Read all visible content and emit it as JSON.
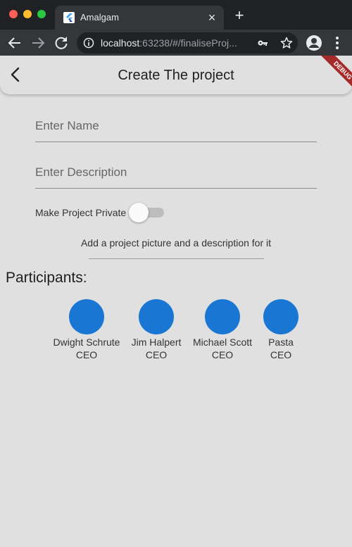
{
  "browser": {
    "tab": {
      "title": "Amalgam"
    },
    "address": {
      "host": "localhost",
      "rest": ":63238/#/finaliseProj..."
    }
  },
  "app": {
    "title": "Create The project",
    "debug_label": "DEBUG",
    "name_field": {
      "placeholder": "Enter Name",
      "value": ""
    },
    "description_field": {
      "placeholder": "Enter Description",
      "value": ""
    },
    "private_toggle": {
      "label": "Make Project Private",
      "on": false
    },
    "picture_prompt": "Add a project picture and a description for it",
    "participants_heading": "Participants:",
    "participants": [
      {
        "name": "Dwight Schrute",
        "role": "CEO"
      },
      {
        "name": "Jim Halpert",
        "role": "CEO"
      },
      {
        "name": "Michael Scott",
        "role": "CEO"
      },
      {
        "name": "Pasta",
        "role": "CEO"
      }
    ]
  },
  "colors": {
    "avatar": "#1976d2",
    "background": "#e0e0e0",
    "debug_ribbon": "#a52a2a",
    "chrome_dark": "#202124",
    "chrome_toolbar": "#35363a"
  },
  "icons": {
    "tab_favicon": "flutter-logo-icon",
    "tab_close": "close-icon",
    "new_tab": "plus-icon",
    "nav_back": "arrow-left-icon",
    "nav_forward": "arrow-right-icon",
    "reload": "reload-icon",
    "site_info": "info-icon",
    "password": "key-icon",
    "bookmark": "star-icon",
    "profile": "account-icon",
    "menu": "more-vertical-icon",
    "app_back": "chevron-left-icon"
  }
}
